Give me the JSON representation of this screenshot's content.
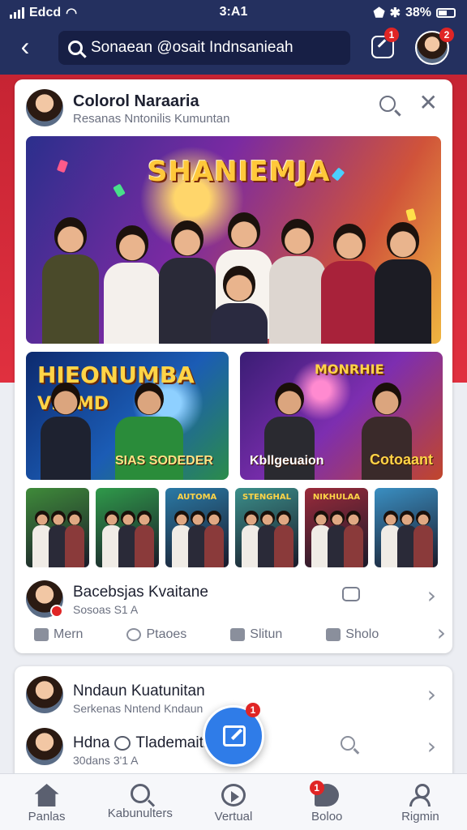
{
  "status_bar": {
    "carrier": "Edcd",
    "time": "3:A1",
    "battery": "38%"
  },
  "header": {
    "search_value": "Sonaean @osait Indnsanieah",
    "compose_badge": "1",
    "profile_badge": "2"
  },
  "post": {
    "author": "Colorol Naraaria",
    "subtitle": "Resanas Nntonilis Kumuntan",
    "hero_title": "SHANIEMJA",
    "thumb_a_title": "HIEONUMBA",
    "thumb_a_title2": "VE IMD",
    "thumb_a_caption": "SIAS SODEDER",
    "thumb_b_title": "MONRHIE",
    "thumb_b_caption": "Kbllgeuaion",
    "thumb_b_caption2": "Cotoaant",
    "small_thumbs": [
      {
        "bg": "#3f8b3a",
        "label": ""
      },
      {
        "bg": "#2f9a4a",
        "label": ""
      },
      {
        "bg": "#2a7aa6",
        "label": "AUTOMA"
      },
      {
        "bg": "#3b8f8a",
        "label": "STENGHAL"
      },
      {
        "bg": "#9a2a3a",
        "label": "NIKHULAA"
      },
      {
        "bg": "#3a8fc2",
        "label": ""
      }
    ],
    "comment_author": "Bacebsjas Kvaitane",
    "comment_meta": "Sosoas S1 A",
    "actions": [
      {
        "icon": "like-icon",
        "label": "Mern"
      },
      {
        "icon": "refresh-icon",
        "label": "Ptaoes"
      },
      {
        "icon": "share-icon",
        "label": "Slitun"
      },
      {
        "icon": "comment-icon",
        "label": "Sholo"
      }
    ]
  },
  "second_card": {
    "row1_name": "Nndaun Kuatunitan",
    "row1_sub": "Serkenas Nntend Kndaun",
    "row2_name_a": "Hdna",
    "row2_name_b": "Tlademaitn",
    "row2_sub": "30dans 3'1 A",
    "fab_badge": "1"
  },
  "bottom_nav": [
    {
      "icon": "home-icon",
      "label": "Panlas"
    },
    {
      "icon": "search-icon",
      "label": "Kabunulters"
    },
    {
      "icon": "video-icon",
      "label": "Vertual"
    },
    {
      "icon": "chat-icon",
      "label": "Boloo",
      "badge": "1"
    },
    {
      "icon": "profile-icon",
      "label": "Rigmin"
    }
  ],
  "colors": {
    "header": "#24305f",
    "accent": "#2f7ce8",
    "band": "#c62433",
    "badge": "#e02525"
  }
}
